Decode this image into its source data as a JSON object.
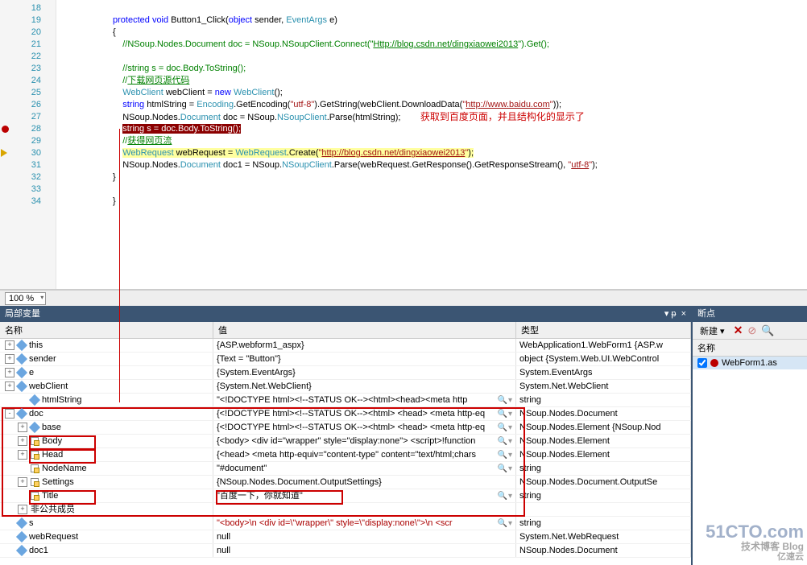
{
  "code": {
    "lines": [
      {
        "n": 18,
        "html": ""
      },
      {
        "n": 19,
        "html": "<span class='kw'>protected</span> <span class='kw'>void</span> Button1_Click(<span class='kw'>object</span> sender, <span class='type'>EventArgs</span> e)"
      },
      {
        "n": 20,
        "html": "{"
      },
      {
        "n": 21,
        "html": "    <span class='com'>//NSoup.Nodes.Document doc = NSoup.NSoupClient.Connect(\"<span class='underline'>Http://blog.csdn.net/dingxiaowei2013</span>\").Get();</span>"
      },
      {
        "n": 22,
        "html": ""
      },
      {
        "n": 23,
        "html": "    <span class='com'>//string s = doc.Body.ToString();</span>"
      },
      {
        "n": 24,
        "html": "    <span class='com'>//<span class='underline'>下载网页源代码</span></span>"
      },
      {
        "n": 25,
        "html": "    <span class='type'>WebClient</span> webClient = <span class='kw'>new</span> <span class='type'>WebClient</span>();"
      },
      {
        "n": 26,
        "html": "    <span class='kw'>string</span> htmlString = <span class='type'>Encoding</span>.GetEncoding(<span class='str'>\"utf-8\"</span>).GetString(webClient.DownloadData(<span class='str'>\"<span class='underline'>http://www.baidu.com</span>\"</span>));"
      },
      {
        "n": 27,
        "html": "    NSoup.Nodes.<span class='type'>Document</span> doc = NSoup.<span class='type'>NSoupClient</span>.Parse(htmlString);        <span class='annot-red'>获取到百度页面，并且结构化的显示了</span>"
      },
      {
        "n": 28,
        "html": "    <span class='red-strike'>string s = doc.Body.ToString();</span>"
      },
      {
        "n": 29,
        "html": "    <span class='com'>//<span class='underline'>获得网页流</span></span>"
      },
      {
        "n": 30,
        "html": "    <span class='hl'><span class='type'>WebRequest</span> webRequest = <span class='type'>WebRequest</span>.Create(<span class='str'>\"<span class='underline'>http://blog.csdn.net/dingxiaowei2013</span>\"</span>);</span>"
      },
      {
        "n": 31,
        "html": "    NSoup.Nodes.<span class='type'>Document</span> doc1 = NSoup.<span class='type'>NSoupClient</span>.Parse(webRequest.GetResponse().GetResponseStream(), <span class='str'>\"<span class='underline'>utf-8</span>\"</span>);"
      },
      {
        "n": 32,
        "html": "}"
      },
      {
        "n": 33,
        "html": ""
      },
      {
        "n": 34,
        "html": "}"
      }
    ],
    "breakpoints": {
      "28": "red",
      "30": "yellow"
    }
  },
  "zoom": "100 %",
  "locals": {
    "title": "局部变量",
    "headers": {
      "name": "名称",
      "value": "值",
      "type": "类型"
    },
    "rows": [
      {
        "ind": 0,
        "exp": "+",
        "icon": "d",
        "name": "this",
        "value": "{ASP.webform1_aspx}",
        "type": "WebApplication1.WebForm1 {ASP.w",
        "mag": false
      },
      {
        "ind": 0,
        "exp": "+",
        "icon": "d",
        "name": "sender",
        "value": "{Text = \"Button\"}",
        "type": "object {System.Web.UI.WebControl",
        "mag": false
      },
      {
        "ind": 0,
        "exp": "+",
        "icon": "d",
        "name": "e",
        "value": "{System.EventArgs}",
        "type": "System.EventArgs",
        "mag": false
      },
      {
        "ind": 0,
        "exp": "+",
        "icon": "d",
        "name": "webClient",
        "value": "{System.Net.WebClient}",
        "type": "System.Net.WebClient",
        "mag": false
      },
      {
        "ind": 1,
        "exp": "",
        "icon": "d",
        "name": "htmlString",
        "value": "\"<!DOCTYPE html><!--STATUS OK--><html><head><meta http",
        "type": "string",
        "mag": true
      },
      {
        "ind": 0,
        "exp": "-",
        "icon": "d",
        "name": "doc",
        "value": "{<!DOCTYPE html><!--STATUS OK--><html> <head>  <meta http-eq",
        "type": "NSoup.Nodes.Document",
        "mag": true
      },
      {
        "ind": 1,
        "exp": "+",
        "icon": "d",
        "name": "base",
        "value": "{<!DOCTYPE html><!--STATUS OK--><html> <head>  <meta http-eq",
        "type": "NSoup.Nodes.Element {NSoup.Nod",
        "mag": true
      },
      {
        "ind": 1,
        "exp": "+",
        "icon": "p",
        "name": "Body",
        "value": "{<body>  <div id=\"wrapper\" style=\"display:none\">   <script>!function",
        "type": "NSoup.Nodes.Element",
        "mag": true
      },
      {
        "ind": 1,
        "exp": "+",
        "icon": "p",
        "name": "Head",
        "value": "{<head>  <meta http-equiv=\"content-type\" content=\"text/html;chars",
        "type": "NSoup.Nodes.Element",
        "mag": true
      },
      {
        "ind": 1,
        "exp": "",
        "icon": "p",
        "name": "NodeName",
        "value": "\"#document\"",
        "type": "string",
        "mag": true
      },
      {
        "ind": 1,
        "exp": "+",
        "icon": "p",
        "name": "Settings",
        "value": "{NSoup.Nodes.Document.OutputSettings}",
        "type": "NSoup.Nodes.Document.OutputSe",
        "mag": false
      },
      {
        "ind": 1,
        "exp": "",
        "icon": "p",
        "name": "Title",
        "value": "\"百度一下，你就知道\"",
        "type": "string",
        "mag": true
      },
      {
        "ind": 1,
        "exp": "+",
        "icon": "",
        "name": "非公共成员",
        "value": "",
        "type": "",
        "mag": false
      },
      {
        "ind": 0,
        "exp": "",
        "icon": "d",
        "name": "s",
        "value": "\"<body>\\n <div id=\\\"wrapper\\\" style=\\\"display:none\\\">\\n  <scr",
        "valclr": "#a00",
        "type": "string",
        "mag": true
      },
      {
        "ind": 0,
        "exp": "",
        "icon": "d",
        "name": "webRequest",
        "value": "null",
        "type": "System.Net.WebRequest",
        "mag": false
      },
      {
        "ind": 0,
        "exp": "",
        "icon": "d",
        "name": "doc1",
        "value": "null",
        "type": "NSoup.Nodes.Document",
        "mag": false
      }
    ]
  },
  "breakpoints": {
    "title": "断点",
    "newLabel": "新建",
    "header": "名称",
    "item": "WebForm1.as"
  },
  "watermark": {
    "big": "51CTO.com",
    "mid": "技术博客 Blog",
    "small": "亿速云"
  }
}
